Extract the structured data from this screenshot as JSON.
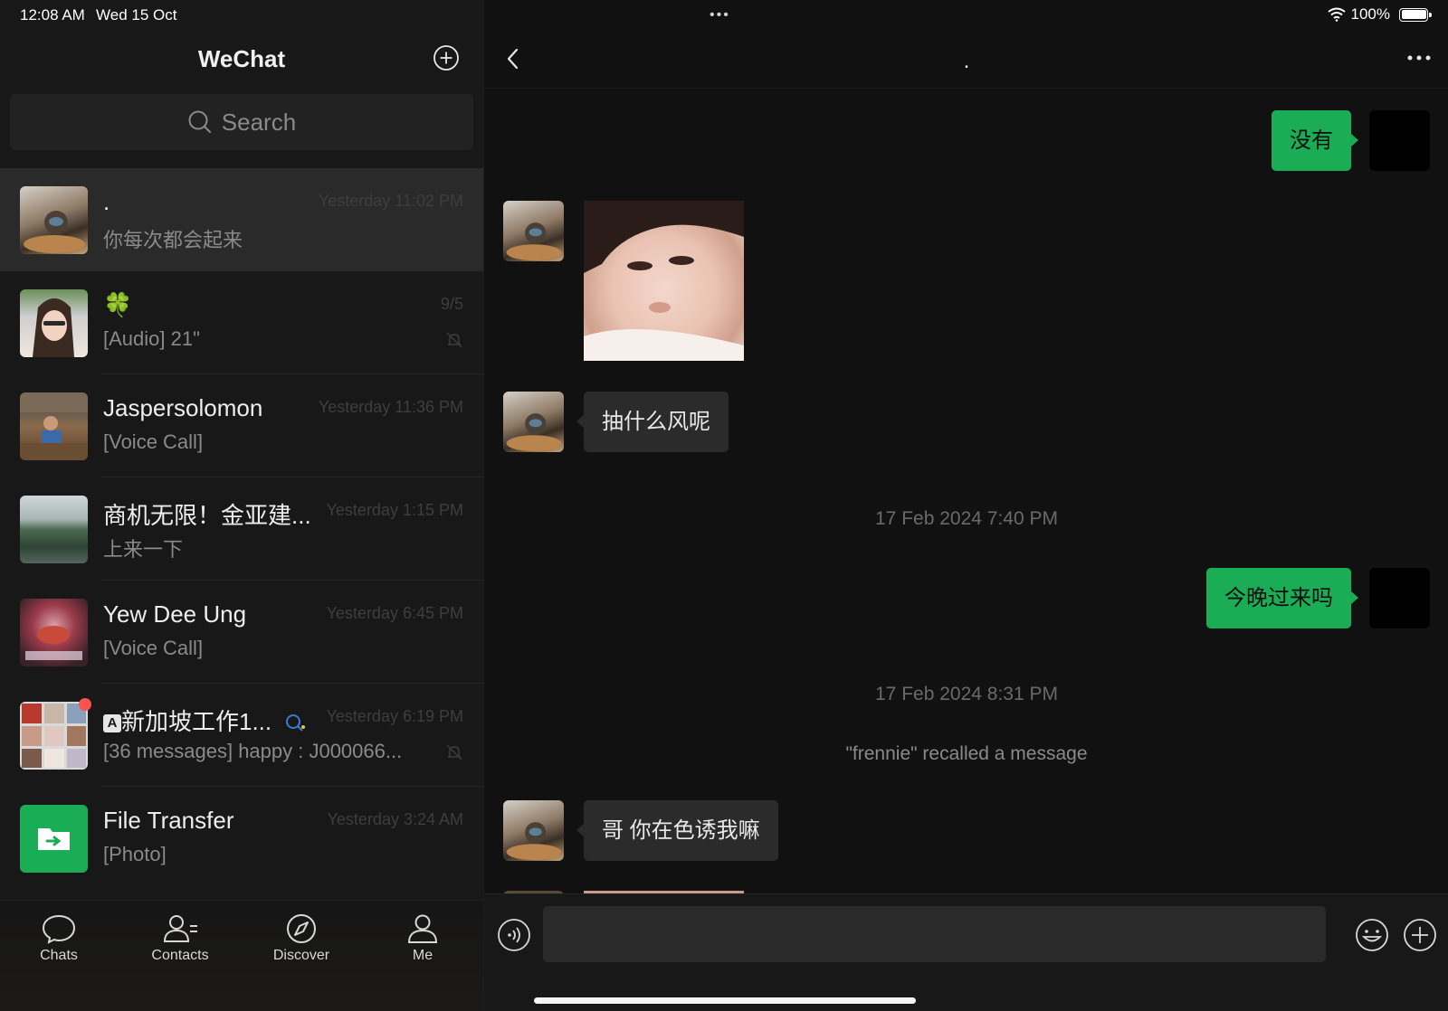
{
  "status_bar": {
    "time": "12:08 AM",
    "date": "Wed 15 Oct",
    "dots": "•••",
    "battery": "100%"
  },
  "sidebar": {
    "title": "WeChat",
    "search_placeholder": "Search",
    "chats": [
      {
        "name": ".",
        "preview": "你每次都会起来",
        "time": "Yesterday 11:02 PM",
        "muted": false,
        "active": true
      },
      {
        "name": "🍀",
        "preview": "[Audio]  21\"",
        "time": "9/5",
        "muted": true,
        "active": false
      },
      {
        "name": "Jaspersolomon",
        "preview": "[Voice Call]",
        "time": "Yesterday 11:36 PM",
        "muted": false,
        "active": false
      },
      {
        "name": "商机无限！金亚建...",
        "preview": "上来一下",
        "time": "Yesterday 1:15 PM",
        "muted": false,
        "active": false
      },
      {
        "name": "Yew Dee Ung",
        "preview": "[Voice Call]",
        "time": "Yesterday 6:45 PM",
        "muted": false,
        "active": false
      },
      {
        "name": "新加坡工作1...",
        "preview": "[36 messages] happy : J000066...",
        "time": "Yesterday 6:19 PM",
        "muted": true,
        "active": false
      },
      {
        "name": "File Transfer",
        "preview": "[Photo]",
        "time": "Yesterday 3:24 AM",
        "muted": false,
        "active": false
      }
    ],
    "group_prefix_icon": "A",
    "tabs": [
      {
        "label": "Chats",
        "icon": "chat-bubble-icon"
      },
      {
        "label": "Contacts",
        "icon": "contacts-icon"
      },
      {
        "label": "Discover",
        "icon": "compass-icon"
      },
      {
        "label": "Me",
        "icon": "person-icon"
      }
    ]
  },
  "conversation": {
    "title": ".",
    "messages": [
      {
        "type": "text",
        "direction": "out",
        "text": "没有"
      },
      {
        "type": "image",
        "direction": "in"
      },
      {
        "type": "text",
        "direction": "in",
        "text": "抽什么风呢"
      },
      {
        "type": "timestamp",
        "text": "17 Feb 2024 7:40 PM"
      },
      {
        "type": "text",
        "direction": "out",
        "text": "今晚过来吗"
      },
      {
        "type": "timestamp",
        "text": "17 Feb 2024 8:31 PM"
      },
      {
        "type": "system",
        "text": "\"frennie\" recalled a message"
      },
      {
        "type": "text",
        "direction": "in",
        "text": "哥  你在色诱我嘛"
      }
    ],
    "input_value": ""
  },
  "colors": {
    "accent_green": "#1aad55",
    "unread_red": "#fa5151",
    "file_transfer_green": "#1aad55"
  }
}
